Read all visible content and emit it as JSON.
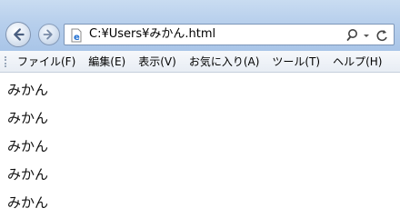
{
  "browser": {
    "address_url": "C:¥Users¥みかん.html",
    "icons": {
      "back": "back-arrow-icon",
      "forward": "forward-arrow-icon",
      "page": "ie-page-icon",
      "search": "search-icon",
      "dropdown": "chevron-down-icon",
      "refresh": "refresh-icon"
    }
  },
  "menu": {
    "items": [
      {
        "label": "ファイル(F)"
      },
      {
        "label": "編集(E)"
      },
      {
        "label": "表示(V)"
      },
      {
        "label": "お気に入り(A)"
      },
      {
        "label": "ツール(T)"
      },
      {
        "label": "ヘルプ(H)"
      }
    ]
  },
  "page": {
    "lines": [
      "みかん",
      "みかん",
      "みかん",
      "みかん",
      "みかん"
    ]
  },
  "colors": {
    "titlebar": "#b7cfec",
    "menubar": "#eef2f7",
    "page_background": "#ffffff"
  }
}
